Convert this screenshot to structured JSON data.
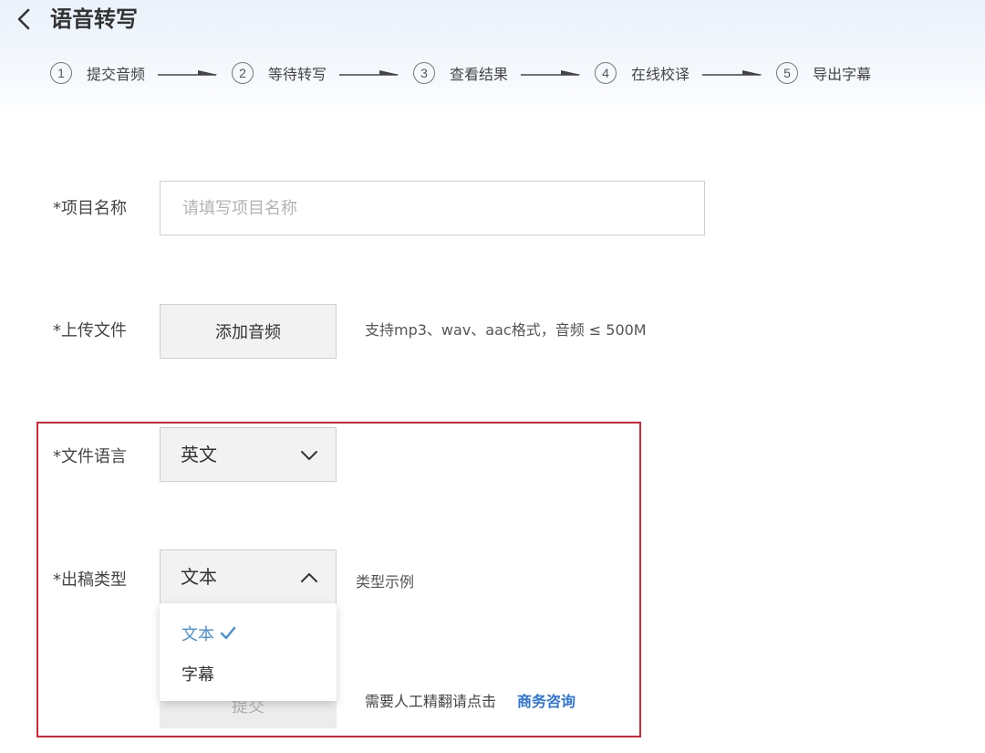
{
  "header": {
    "title": "语音转写",
    "steps": [
      {
        "num": "1",
        "label": "提交音频"
      },
      {
        "num": "2",
        "label": "等待转写"
      },
      {
        "num": "3",
        "label": "查看结果"
      },
      {
        "num": "4",
        "label": "在线校译"
      },
      {
        "num": "5",
        "label": "导出字幕"
      }
    ]
  },
  "form": {
    "project_name": {
      "label": "*项目名称",
      "placeholder": "请填写项目名称",
      "value": ""
    },
    "upload": {
      "label": "*上传文件",
      "button": "添加音频",
      "hint": "支持mp3、wav、aac格式，音频 ≤ 500M"
    },
    "language": {
      "label": "*文件语言",
      "selected": "英文"
    },
    "output_type": {
      "label": "*出稿类型",
      "selected": "文本",
      "example_link": "类型示例",
      "options": [
        "文本",
        "字幕"
      ]
    },
    "submit": {
      "label": "提交"
    },
    "contact": {
      "text": "需要人工精翻请点击",
      "link": "商务咨询"
    }
  },
  "colors": {
    "accent": "#4a90d9",
    "link": "#2e74d8",
    "highlight_frame": "#d9243a"
  }
}
